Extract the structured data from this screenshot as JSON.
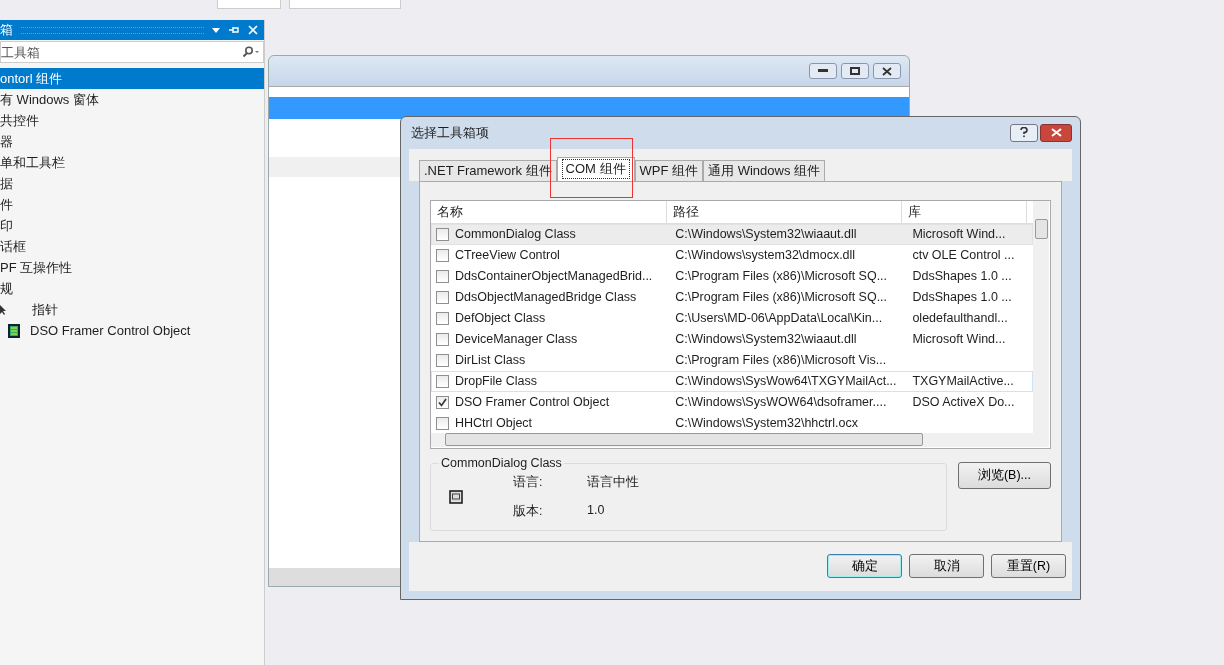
{
  "toolbox": {
    "title": "箱",
    "search": {
      "placeholder": "工具箱"
    },
    "items": [
      {
        "label": "ontorl 组件",
        "selected": true
      },
      {
        "label": "有 Windows 窗体",
        "selected": false
      },
      {
        "label": "共控件",
        "selected": false
      },
      {
        "label": "器",
        "selected": false
      },
      {
        "label": "单和工具栏",
        "selected": false
      },
      {
        "label": "据",
        "selected": false
      },
      {
        "label": "件",
        "selected": false
      },
      {
        "label": "印",
        "selected": false
      },
      {
        "label": "话框",
        "selected": false
      },
      {
        "label": "PF 互操作性",
        "selected": false
      },
      {
        "label": "规",
        "selected": false,
        "children": [
          {
            "label": "指针",
            "kind": "pointer",
            "selected": false
          },
          {
            "label": "DSO Framer Control Object",
            "kind": "control",
            "selected": false
          }
        ]
      }
    ]
  },
  "dialog": {
    "title": "选择工具箱项",
    "tabs": [
      {
        "label": ".NET Framework 组件",
        "selected": false
      },
      {
        "label": "COM 组件",
        "selected": true
      },
      {
        "label": "WPF 组件",
        "selected": false
      },
      {
        "label": "通用 Windows 组件",
        "selected": false
      }
    ],
    "table": {
      "columns": [
        "名称",
        "路径",
        "库"
      ],
      "rows": [
        {
          "name": "CommonDialog Class",
          "path": "C:\\Windows\\System32\\wiaaut.dll",
          "library": "Microsoft Wind...",
          "checked": false,
          "selected": true,
          "hovered": false
        },
        {
          "name": "CTreeView Control",
          "path": "C:\\Windows\\system32\\dmocx.dll",
          "library": "ctv OLE Control ...",
          "checked": false,
          "selected": false,
          "hovered": false
        },
        {
          "name": "DdsContainerObjectManagedBrid...",
          "path": "C:\\Program Files (x86)\\Microsoft SQ...",
          "library": "DdsShapes 1.0 ...",
          "checked": false,
          "selected": false,
          "hovered": false
        },
        {
          "name": "DdsObjectManagedBridge Class",
          "path": "C:\\Program Files (x86)\\Microsoft SQ...",
          "library": "DdsShapes 1.0 ...",
          "checked": false,
          "selected": false,
          "hovered": false
        },
        {
          "name": "DefObject Class",
          "path": "C:\\Users\\MD-06\\AppData\\Local\\Kin...",
          "library": "oledefaulthandl...",
          "checked": false,
          "selected": false,
          "hovered": false
        },
        {
          "name": "DeviceManager Class",
          "path": "C:\\Windows\\System32\\wiaaut.dll",
          "library": "Microsoft Wind...",
          "checked": false,
          "selected": false,
          "hovered": false
        },
        {
          "name": "DirList Class",
          "path": "C:\\Program Files (x86)\\Microsoft Vis...",
          "checked": false,
          "selected": false,
          "hovered": false
        },
        {
          "name": "DropFile Class",
          "path": "C:\\Windows\\SysWow64\\TXGYMailAct...",
          "library": "TXGYMailActive...",
          "checked": false,
          "selected": false,
          "hovered": true
        },
        {
          "name": "DSO Framer Control Object",
          "path": "C:\\Windows\\SysWOW64\\dsoframer....",
          "library": "DSO ActiveX Do...",
          "checked": true,
          "selected": false,
          "hovered": false
        },
        {
          "name": "HHCtrl Object",
          "path": "C:\\Windows\\System32\\hhctrl.ocx",
          "checked": false,
          "selected": false,
          "hovered": false
        }
      ]
    },
    "details": {
      "title": "CommonDialog Class",
      "fields": [
        {
          "label": "语言:",
          "value": "语言中性"
        },
        {
          "label": "版本:",
          "value": "1.0"
        }
      ]
    },
    "browse_button": "浏览(B)...",
    "buttons": [
      {
        "label": "确定",
        "default": true
      },
      {
        "label": "取消",
        "default": false
      },
      {
        "label": "重置(R)",
        "default": false
      }
    ]
  }
}
